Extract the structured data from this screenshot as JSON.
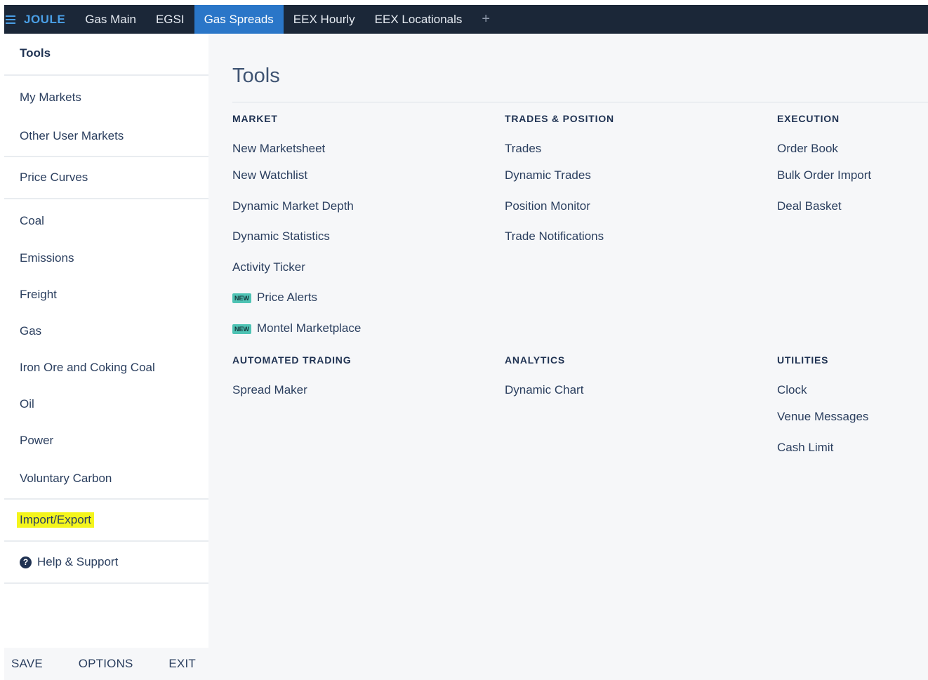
{
  "topbar": {
    "brand": "JOULE",
    "tabs": [
      "Gas Main",
      "EGSI",
      "Gas Spreads",
      "EEX Hourly",
      "EEX Locationals"
    ],
    "active_tab": "Gas Spreads",
    "add_tab": "+"
  },
  "sidebar": {
    "header": "Tools",
    "group1": [
      "My Markets",
      "Other User Markets"
    ],
    "group2": [
      "Price Curves"
    ],
    "group3": [
      "Coal",
      "Emissions",
      "Freight",
      "Gas",
      "Iron Ore and Coking Coal",
      "Oil",
      "Power",
      "Voluntary Carbon"
    ],
    "import_export": "Import/Export",
    "help": "Help & Support",
    "footer": {
      "save": "SAVE",
      "options": "OPTIONS",
      "exit": "EXIT"
    }
  },
  "main": {
    "title": "Tools",
    "market": {
      "heading": "MARKET",
      "items": [
        "New Marketsheet",
        "New Watchlist",
        "Dynamic Market Depth",
        "Dynamic Statistics",
        "Activity Ticker"
      ],
      "new_badge": "NEW",
      "new_items": [
        "Price Alerts",
        "Montel Marketplace"
      ]
    },
    "trades": {
      "heading": "TRADES & POSITION",
      "items": [
        "Trades",
        "Dynamic Trades",
        "Position Monitor",
        "Trade Notifications"
      ]
    },
    "execution": {
      "heading": "EXECUTION",
      "items": [
        "Order Book",
        "Bulk Order Import",
        "Deal Basket"
      ]
    },
    "automated": {
      "heading": "AUTOMATED TRADING",
      "items": [
        "Spread Maker"
      ]
    },
    "analytics": {
      "heading": "ANALYTICS",
      "items": [
        "Dynamic Chart"
      ]
    },
    "utilities": {
      "heading": "UTILITIES",
      "items": [
        "Clock",
        "Venue Messages",
        "Cash Limit"
      ]
    }
  },
  "colors": {
    "topbar_bg": "#1b2738",
    "active_tab": "#2a76c8",
    "brand": "#4a9fe6",
    "highlight": "#f4f51c",
    "new_badge": "#4ec3b4"
  }
}
